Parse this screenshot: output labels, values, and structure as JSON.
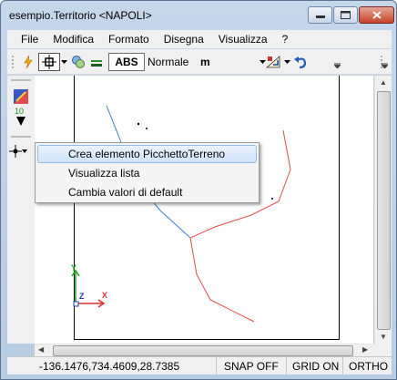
{
  "window": {
    "title": "esempio.Territorio <NAPOLI>"
  },
  "menu": [
    "File",
    "Modifica",
    "Formato",
    "Disegna",
    "Visualizza",
    "?"
  ],
  "toolbar": {
    "abs_label": "ABS",
    "style_label": "Normale",
    "units_value": "m"
  },
  "leftbar": {
    "counter": "10"
  },
  "context_menu": {
    "items": [
      {
        "label": "Crea elemento PicchettoTerreno",
        "highlighted": true
      },
      {
        "label": "Visualizza lista",
        "highlighted": false
      },
      {
        "label": "Cambia valori di default",
        "highlighted": false
      }
    ]
  },
  "axes": {
    "x": "X",
    "y": "Y",
    "z": "Z"
  },
  "status": {
    "coords": "-136.1476,734.4609,28.7385",
    "snap": "SNAP OFF",
    "grid": "GRID ON",
    "ortho": "ORTHO O"
  },
  "colors": {
    "line_red": "#e04b4b",
    "line_blue": "#3a7fd0",
    "highlight": "#cfe4fb"
  }
}
